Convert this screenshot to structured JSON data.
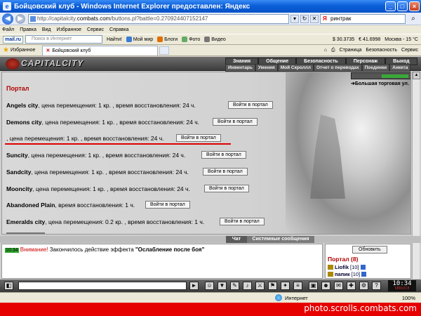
{
  "window": {
    "title": "Бойцовский клуб - Windows Internet Explorer предоставлен: Яндекс",
    "minimize": "_",
    "maximize": "□",
    "close": "×"
  },
  "address": {
    "url_prefix": "http://capitalcity.",
    "url_domain": "combats.com",
    "url_rest": "/buttons.pl?battle=0.270924407152147",
    "search_value": "ринтрак"
  },
  "menu": [
    "Файл",
    "Правка",
    "Вид",
    "Избранное",
    "Сервис",
    "Справка"
  ],
  "toolbar2": {
    "mailru": "mail.ru",
    "search_placeholder": "Поиск в Интернет",
    "find": "Найти!",
    "items": [
      "Мой мир",
      "Блоги",
      "Фото",
      "Видео"
    ],
    "rate_usd": "$ 30.3735",
    "rate_eur": "€ 41.6998",
    "weather": "Москва - 15 °C"
  },
  "tabs": {
    "favorites": "Избранное",
    "active_tab": "Бойцовский клуб",
    "page_menu": "Страница",
    "security_menu": "Безопасность",
    "tools_menu": "Сервис"
  },
  "game": {
    "logo_text": "CAPITALCITY",
    "menu_top": [
      "Знания",
      "Общение",
      "Безопасность",
      "Персонаж",
      "Выход"
    ],
    "menu_sub": [
      "Инвентарь",
      "Умения",
      "Мой Скроллл",
      "Отчет о переводах",
      "Поединки",
      "Анкета"
    ],
    "location": "Большая торговая ул.",
    "portal_title": "Портал",
    "enter_label": "Войти в портал",
    "rows": [
      {
        "city": "Angels city",
        "text": ", цена перемещения: 1 кр. , время восстановления: 24 ч."
      },
      {
        "city": "Demons city",
        "text": ", цена перемещения: 1 кр. , время восстановления: 24 ч."
      },
      {
        "city": "",
        "text": ", цена перемещения: 1 кр. , время восстановления: 24 ч."
      },
      {
        "city": "Suncity",
        "text": ", цена перемещения: 1 кр. , время восстановления: 24 ч."
      },
      {
        "city": "Sandcity",
        "text": ", цена перемещения: 1 кр. , время восстановления: 24 ч."
      },
      {
        "city": "Mooncity",
        "text": ", цена перемещения: 1 кр. , время восстановления: 24 ч."
      },
      {
        "city": "Abandoned Plain",
        "text": ", время восстановления: 1 ч."
      },
      {
        "city": "Emeralds city",
        "text": ", цена перемещения: 0.2 кр. , время восстановления: 1 ч."
      }
    ],
    "chat_tab": "Чат",
    "system_tab": "Системные сообщения",
    "chat": {
      "time": "10:34",
      "warn": "Внимание!",
      "message": " Закончилось действие эффекта ",
      "effect": "\"Ослабление после боя\""
    },
    "refresh": "Обновить",
    "room": "Портал (8)",
    "users": [
      {
        "name": "Liofik",
        "level": "[10]"
      },
      {
        "name": "папик",
        "level": "[10]"
      }
    ],
    "clock": "10:34",
    "clock_sub": "SERVICE"
  },
  "status": {
    "zone": "Интернет",
    "zoom": "100%"
  },
  "watermark": "photo.scrolls.combats.com"
}
